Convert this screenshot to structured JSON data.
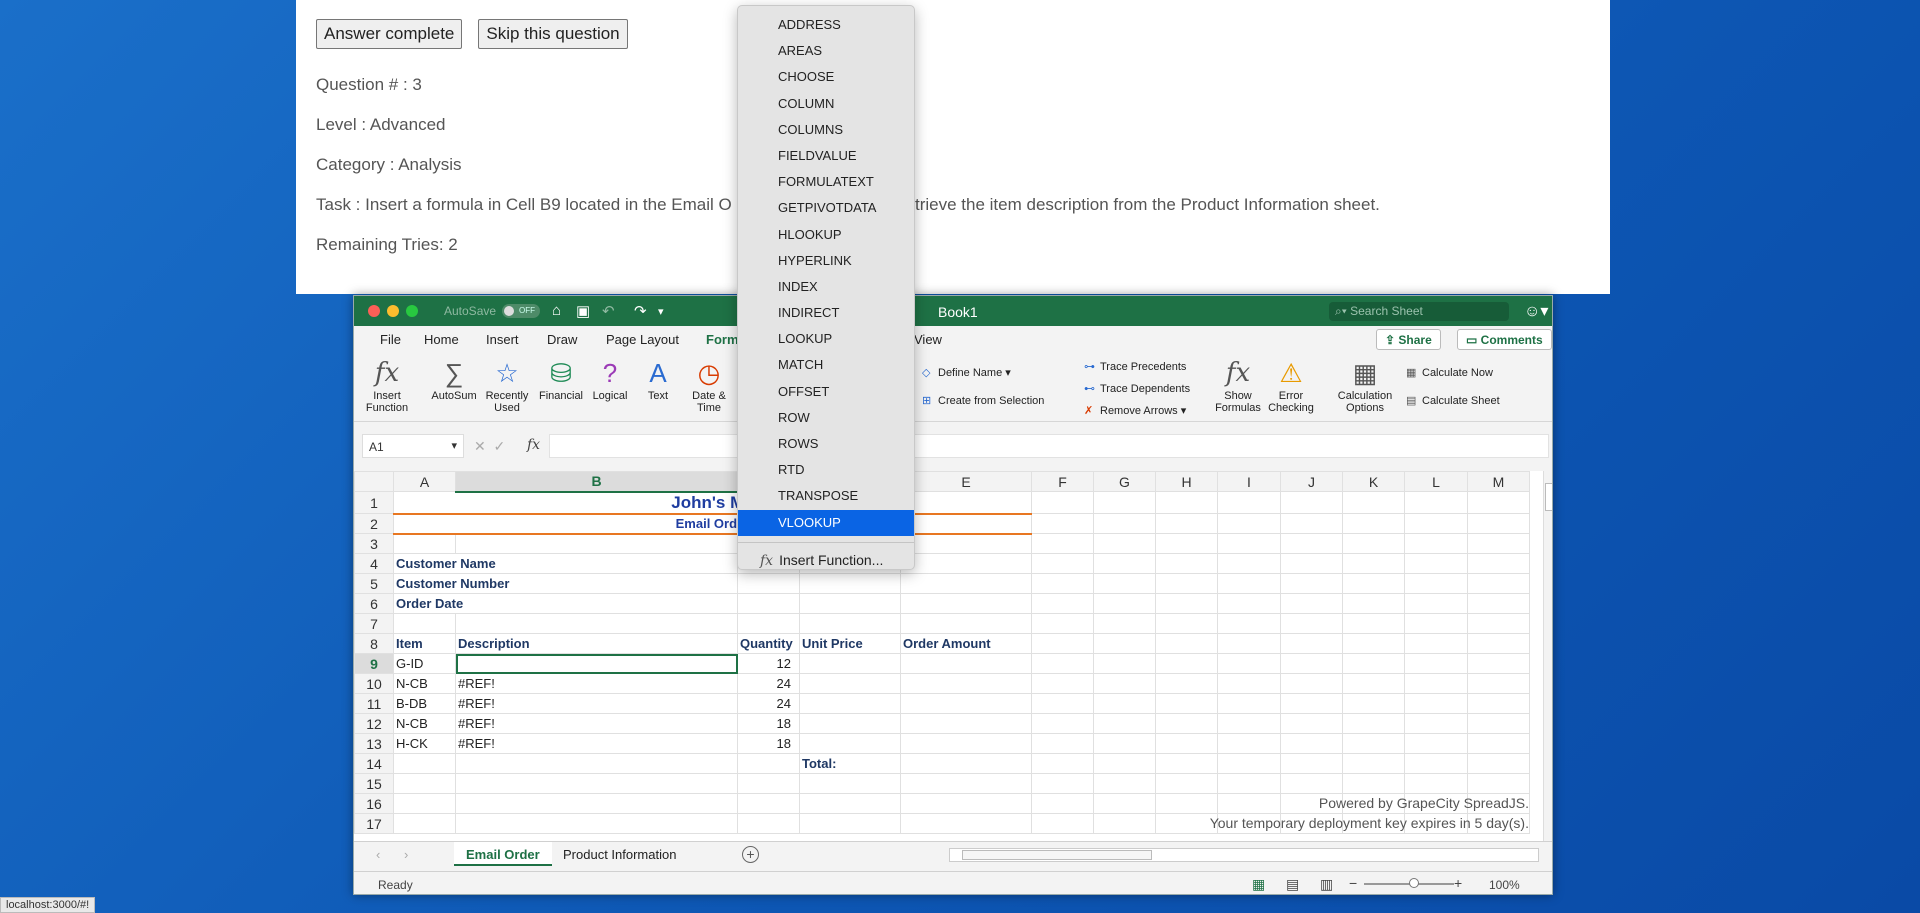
{
  "task": {
    "answer_complete": "Answer complete",
    "skip": "Skip this question",
    "question": "Question # : 3",
    "level": "Level : Advanced",
    "category": "Category : Analysis",
    "task_text": "Task : Insert a formula in Cell B9 located in the Email O",
    "task_text_end": "trieve the item description from the Product Information sheet.",
    "remaining": "Remaining Tries: 2"
  },
  "window": {
    "autosave": "AutoSave",
    "toggle": "OFF",
    "book_title": "Book1",
    "search_placeholder": "Search Sheet"
  },
  "menu": {
    "file": "File",
    "home": "Home",
    "insert": "Insert",
    "draw": "Draw",
    "page_layout": "Page Layout",
    "formulas": "Form",
    "view": "View",
    "share": "Share",
    "comments": "Comments"
  },
  "ribbon": {
    "insert_function": "Insert Function",
    "autosum": "AutoSum",
    "recently_used": "Recently Used",
    "financial": "Financial",
    "logical": "Logical",
    "text": "Text",
    "date_time": "Date & Time",
    "define_name": "Define Name",
    "create_from_selection": "Create from Selection",
    "trace_precedents": "Trace Precedents",
    "trace_dependents": "Trace Dependents",
    "remove_arrows": "Remove Arrows",
    "show_formulas": "Show Formulas",
    "error_checking": "Error Checking",
    "calculation_options": "Calculation Options",
    "calculate_now": "Calculate Now",
    "calculate_sheet": "Calculate Sheet"
  },
  "formula_bar": {
    "name_box": "A1",
    "fx": "fx"
  },
  "grid": {
    "columns": [
      "A",
      "B",
      "",
      "",
      "E",
      "F",
      "G",
      "H",
      "I",
      "J",
      "K",
      "L",
      "M"
    ],
    "rows": [
      "1",
      "2",
      "3",
      "4",
      "5",
      "6",
      "7",
      "8",
      "9",
      "10",
      "11",
      "12",
      "13",
      "14",
      "15",
      "16",
      "17"
    ],
    "title": "John's Ma",
    "subtitle": "Email Order",
    "customer_name": "Customer Name",
    "customer_number": "Customer Number",
    "order_date": "Order Date",
    "headers": {
      "item": "Item",
      "description": "Description",
      "quantity": "Quantity",
      "unit_price": "Unit Price",
      "order_amount": "Order Amount"
    },
    "items": [
      {
        "item": "G-ID",
        "description": "",
        "quantity": "12"
      },
      {
        "item": "N-CB",
        "description": "#REF!",
        "quantity": "24"
      },
      {
        "item": "B-DB",
        "description": "#REF!",
        "quantity": "24"
      },
      {
        "item": "N-CB",
        "description": "#REF!",
        "quantity": "18"
      },
      {
        "item": "H-CK",
        "description": "#REF!",
        "quantity": "18"
      }
    ],
    "total_label": "Total:",
    "powered_by": "Powered by GrapeCity SpreadJS.",
    "deploy_key": "Your temporary deployment key expires in 5 day(s)."
  },
  "sheets": {
    "tab1": "Email Order",
    "tab2": "Product Information"
  },
  "status": {
    "ready": "Ready",
    "zoom": "100%"
  },
  "dropdown": {
    "items": [
      "ADDRESS",
      "AREAS",
      "CHOOSE",
      "COLUMN",
      "COLUMNS",
      "FIELDVALUE",
      "FORMULATEXT",
      "GETPIVOTDATA",
      "HLOOKUP",
      "HYPERLINK",
      "INDEX",
      "INDIRECT",
      "LOOKUP",
      "MATCH",
      "OFFSET",
      "ROW",
      "ROWS",
      "RTD",
      "TRANSPOSE",
      "VLOOKUP"
    ],
    "selected": "VLOOKUP",
    "insert_function": "Insert Function..."
  },
  "url_hint": "localhost:3000/#!"
}
